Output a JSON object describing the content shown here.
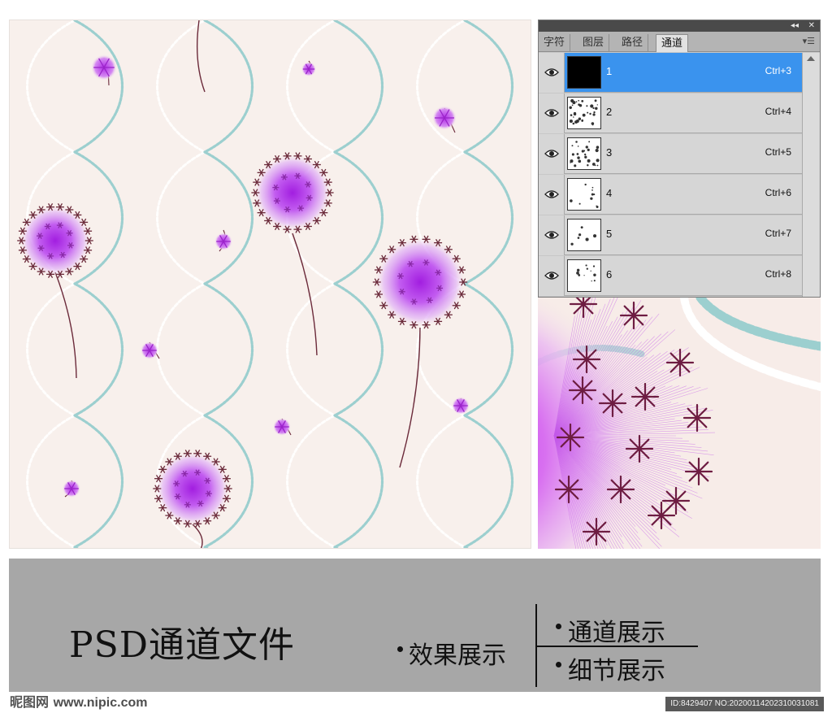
{
  "panel": {
    "title_controls": [
      "◂◂",
      "✕"
    ],
    "tabs": [
      "字符",
      "图层",
      "路径",
      "通道"
    ],
    "active_tab": "通道",
    "menu_icon": "panel-menu-icon",
    "channels": [
      {
        "name": "1",
        "shortcut": "Ctrl+3",
        "selected": true
      },
      {
        "name": "2",
        "shortcut": "Ctrl+4",
        "selected": false
      },
      {
        "name": "3",
        "shortcut": "Ctrl+5",
        "selected": false
      },
      {
        "name": "4",
        "shortcut": "Ctrl+6",
        "selected": false
      },
      {
        "name": "5",
        "shortcut": "Ctrl+7",
        "selected": false
      },
      {
        "name": "6",
        "shortcut": "Ctrl+8",
        "selected": false
      }
    ]
  },
  "banner": {
    "title": "PSD通道文件",
    "effect_label": "效果展示",
    "channels_label": "通道展示",
    "detail_label": "细节展示"
  },
  "footer": {
    "logo": "昵图网",
    "site": "www.nipic.com",
    "image_id": "ID:8429407 NO:20200114202310031081"
  },
  "colors": {
    "pattern_bg": "#f8f0ec",
    "chain": "#9ccfcf",
    "flower": "#b94ce8",
    "stem": "#6b2a3a",
    "selected_row": "#3a93ee",
    "banner_bg": "#a7a7a7"
  }
}
